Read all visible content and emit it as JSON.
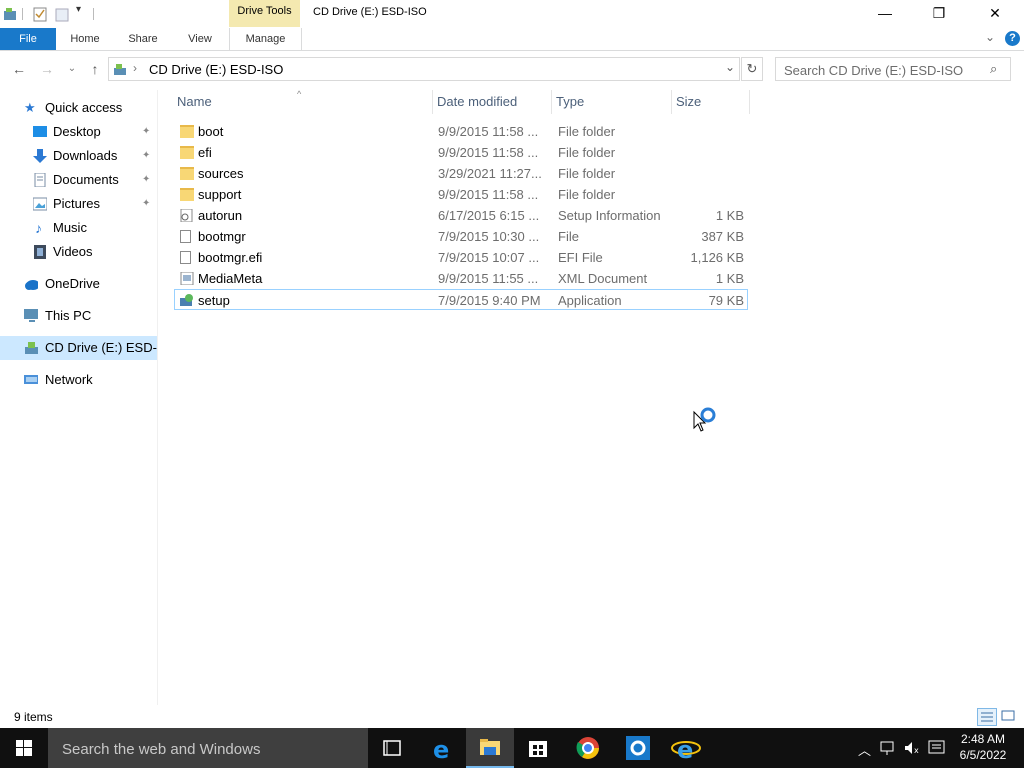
{
  "window": {
    "title": "CD Drive (E:) ESD-ISO",
    "context_tab_group": "Drive Tools",
    "controls": {
      "minimize": "—",
      "restore": "❐",
      "close": "✕"
    }
  },
  "ribbon": {
    "tabs": [
      {
        "label": "File"
      },
      {
        "label": "Home"
      },
      {
        "label": "Share"
      },
      {
        "label": "View"
      },
      {
        "label": "Manage"
      }
    ],
    "expand_glyph": "⌄",
    "help_glyph": "?"
  },
  "address_bar": {
    "path": "CD Drive (E:) ESD-ISO",
    "search_placeholder": "Search CD Drive (E:) ESD-ISO"
  },
  "nav_pane": {
    "items": [
      {
        "label": "Quick access",
        "icon": "star-icon",
        "pinned": false
      },
      {
        "label": "Desktop",
        "icon": "desktop-icon",
        "pinned": true
      },
      {
        "label": "Downloads",
        "icon": "download-arrow-icon",
        "pinned": true
      },
      {
        "label": "Documents",
        "icon": "documents-icon",
        "pinned": true
      },
      {
        "label": "Pictures",
        "icon": "pictures-icon",
        "pinned": true
      },
      {
        "label": "Music",
        "icon": "music-note-icon",
        "pinned": false
      },
      {
        "label": "Videos",
        "icon": "film-icon",
        "pinned": false
      },
      {
        "label": "OneDrive",
        "icon": "cloud-icon",
        "pinned": false
      },
      {
        "label": "This PC",
        "icon": "computer-icon",
        "pinned": false
      },
      {
        "label": "CD Drive (E:) ESD-",
        "icon": "cd-drive-icon",
        "pinned": false,
        "selected": true
      },
      {
        "label": "Network",
        "icon": "network-icon",
        "pinned": false
      }
    ],
    "pin_glyph": "📌"
  },
  "file_list": {
    "columns": [
      "Name",
      "Date modified",
      "Type",
      "Size"
    ],
    "sort_glyph": "^",
    "rows": [
      {
        "name": "boot",
        "date": "9/9/2015 11:58 ...",
        "type": "File folder",
        "size": "",
        "icon": "folder-icon"
      },
      {
        "name": "efi",
        "date": "9/9/2015 11:58 ...",
        "type": "File folder",
        "size": "",
        "icon": "folder-icon"
      },
      {
        "name": "sources",
        "date": "3/29/2021 11:27...",
        "type": "File folder",
        "size": "",
        "icon": "folder-icon"
      },
      {
        "name": "support",
        "date": "9/9/2015 11:58 ...",
        "type": "File folder",
        "size": "",
        "icon": "folder-icon"
      },
      {
        "name": "autorun",
        "date": "6/17/2015 6:15 ...",
        "type": "Setup Information",
        "size": "1 KB",
        "icon": "setup-info-icon"
      },
      {
        "name": "bootmgr",
        "date": "7/9/2015 10:30 ...",
        "type": "File",
        "size": "387 KB",
        "icon": "file-icon"
      },
      {
        "name": "bootmgr.efi",
        "date": "7/9/2015 10:07 ...",
        "type": "EFI File",
        "size": "1,126 KB",
        "icon": "file-icon"
      },
      {
        "name": "MediaMeta",
        "date": "9/9/2015 11:55 ...",
        "type": "XML Document",
        "size": "1 KB",
        "icon": "xml-doc-icon"
      },
      {
        "name": "setup",
        "date": "7/9/2015 9:40 PM",
        "type": "Application",
        "size": "79 KB",
        "icon": "setup-app-icon",
        "selected": true
      }
    ]
  },
  "status_bar": {
    "item_count": "9 items"
  },
  "taskbar": {
    "search_placeholder": "Search the web and Windows",
    "clock_time": "2:48 AM",
    "clock_date": "6/5/2022"
  },
  "colors": {
    "accent": "#1979ca",
    "context_tab": "#f4e9b0",
    "selection": "#cce8ff",
    "taskbar": "#101010"
  }
}
